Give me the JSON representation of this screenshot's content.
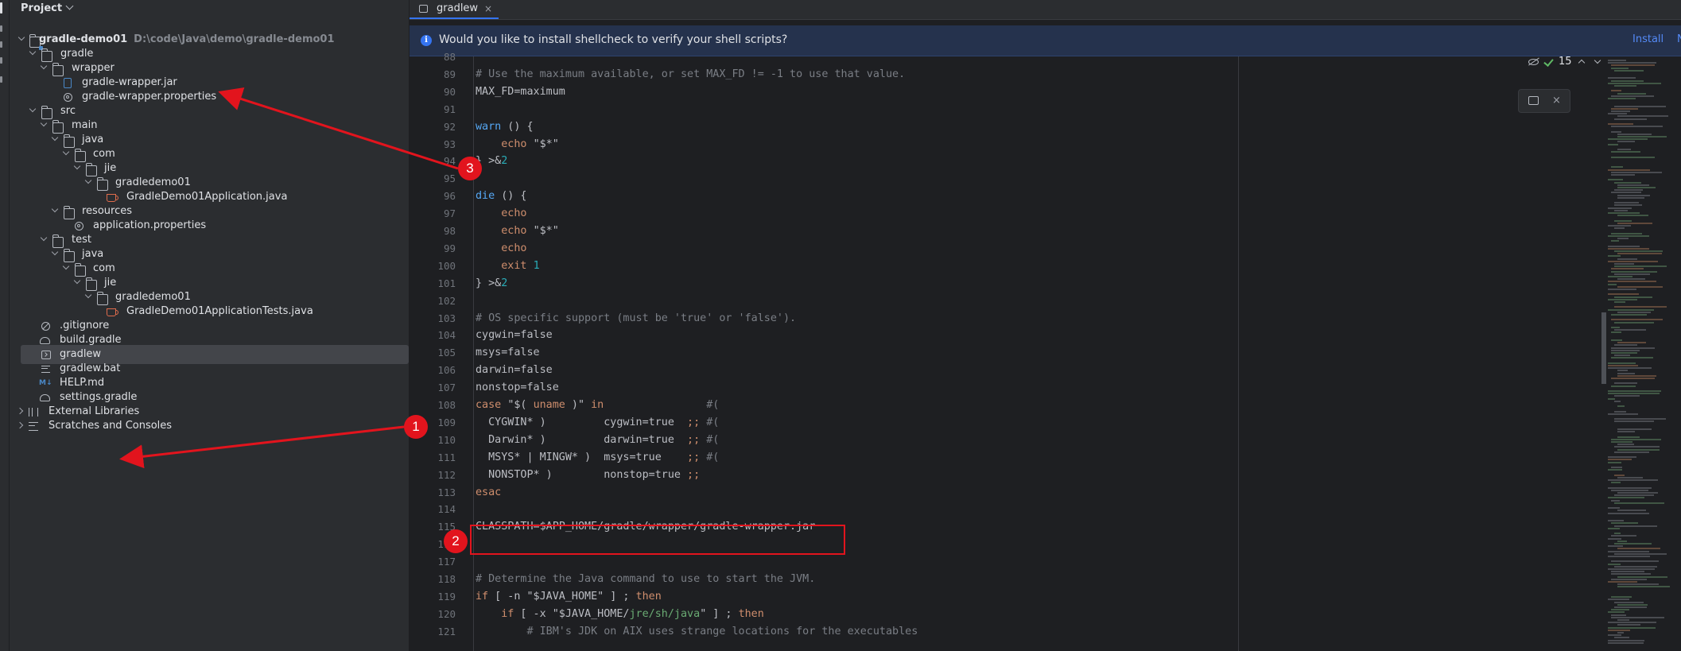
{
  "project_panel": {
    "title": "Project",
    "tree": [
      {
        "label": "gradle-demo01",
        "hint": "D:\\code\\Java\\demo\\gradle-demo01",
        "bold": true
      },
      {
        "label": "gradle"
      },
      {
        "label": "wrapper"
      },
      {
        "label": "gradle-wrapper.jar"
      },
      {
        "label": "gradle-wrapper.properties"
      },
      {
        "label": "src"
      },
      {
        "label": "main"
      },
      {
        "label": "java"
      },
      {
        "label": "com"
      },
      {
        "label": "jie"
      },
      {
        "label": "gradledemo01"
      },
      {
        "label": "GradleDemo01Application.java"
      },
      {
        "label": "resources"
      },
      {
        "label": "application.properties"
      },
      {
        "label": "test"
      },
      {
        "label": "java"
      },
      {
        "label": "com"
      },
      {
        "label": "jie"
      },
      {
        "label": "gradledemo01"
      },
      {
        "label": "GradleDemo01ApplicationTests.java"
      },
      {
        "label": ".gitignore"
      },
      {
        "label": "build.gradle"
      },
      {
        "label": "gradlew"
      },
      {
        "label": "gradlew.bat"
      },
      {
        "label": "HELP.md"
      },
      {
        "label": "settings.gradle"
      },
      {
        "label": "External Libraries"
      },
      {
        "label": "Scratches and Consoles"
      }
    ]
  },
  "editor": {
    "tab_label": "gradlew",
    "tab_close": "×",
    "notification": {
      "text": "Would you like to install shellcheck to verify your shell scripts?",
      "install": "Install",
      "no": "N"
    },
    "inspection_count": "15",
    "popup_close": "×",
    "line_numbers": [
      "88",
      "89",
      "90",
      "91",
      "92",
      "93",
      "94",
      "95",
      "96",
      "97",
      "98",
      "99",
      "100",
      "101",
      "102",
      "103",
      "104",
      "105",
      "106",
      "107",
      "108",
      "109",
      "110",
      "111",
      "112",
      "113",
      "114",
      "115",
      "116",
      "117",
      "118",
      "119",
      "120",
      "121"
    ],
    "code": [
      [],
      [
        {
          "t": "# Use the maximum available, or set MAX_FD != -1 to use that value.",
          "c": "cm"
        }
      ],
      [
        {
          "t": "MAX_FD=maximum",
          "c": ""
        }
      ],
      [],
      [
        {
          "t": "warn",
          "c": "fn"
        },
        {
          "t": " () {",
          "c": ""
        }
      ],
      [
        {
          "t": "    echo ",
          "c": "kw"
        },
        {
          "t": "\"$*\"",
          "c": ""
        }
      ],
      [
        {
          "t": "} >&",
          "c": ""
        },
        {
          "t": "2",
          "c": "nm"
        }
      ],
      [],
      [
        {
          "t": "die",
          "c": "fn"
        },
        {
          "t": " () {",
          "c": ""
        }
      ],
      [
        {
          "t": "    echo",
          "c": "kw"
        }
      ],
      [
        {
          "t": "    echo ",
          "c": "kw"
        },
        {
          "t": "\"$*\"",
          "c": ""
        }
      ],
      [
        {
          "t": "    echo",
          "c": "kw"
        }
      ],
      [
        {
          "t": "    exit ",
          "c": "kw"
        },
        {
          "t": "1",
          "c": "nm"
        }
      ],
      [
        {
          "t": "} >&",
          "c": ""
        },
        {
          "t": "2",
          "c": "nm"
        }
      ],
      [],
      [
        {
          "t": "# OS specific support (must be 'true' or 'false').",
          "c": "cm"
        }
      ],
      [
        {
          "t": "cygwin=false",
          "c": ""
        }
      ],
      [
        {
          "t": "msys=false",
          "c": ""
        }
      ],
      [
        {
          "t": "darwin=false",
          "c": ""
        }
      ],
      [
        {
          "t": "nonstop=false",
          "c": ""
        }
      ],
      [
        {
          "t": "case ",
          "c": "kw"
        },
        {
          "t": "\"$( ",
          "c": ""
        },
        {
          "t": "uname",
          "c": "kw"
        },
        {
          "t": " )\" ",
          "c": ""
        },
        {
          "t": "in",
          "c": "kw"
        },
        {
          "t": "                #(",
          "c": "cm"
        }
      ],
      [
        {
          "t": "  CYGWIN* )         cygwin=true  ",
          "c": ""
        },
        {
          "t": ";;",
          "c": "op"
        },
        {
          "t": " #(",
          "c": "cm"
        }
      ],
      [
        {
          "t": "  Darwin* )         darwin=true  ",
          "c": ""
        },
        {
          "t": ";;",
          "c": "op"
        },
        {
          "t": " #(",
          "c": "cm"
        }
      ],
      [
        {
          "t": "  MSYS* | MINGW* )  msys=true    ",
          "c": ""
        },
        {
          "t": ";;",
          "c": "op"
        },
        {
          "t": " #(",
          "c": "cm"
        }
      ],
      [
        {
          "t": "  NONSTOP* )        nonstop=true ",
          "c": ""
        },
        {
          "t": ";;",
          "c": "op"
        }
      ],
      [
        {
          "t": "esac",
          "c": "kw"
        }
      ],
      [],
      [
        {
          "t": "CLASSPATH=$APP_HOME/gradle/wrapper/gradle-wrapper.jar",
          "c": ""
        }
      ],
      [],
      [],
      [
        {
          "t": "# Determine the Java command to use to start the JVM.",
          "c": "cm"
        }
      ],
      [
        {
          "t": "if",
          "c": "kw"
        },
        {
          "t": " [ -n ",
          "c": ""
        },
        {
          "t": "\"$JAVA_HOME\"",
          "c": ""
        },
        {
          "t": " ] ; ",
          "c": ""
        },
        {
          "t": "then",
          "c": "kw"
        }
      ],
      [
        {
          "t": "    if",
          "c": "kw"
        },
        {
          "t": " [ -x ",
          "c": ""
        },
        {
          "t": "\"$JAVA_HOME/",
          "c": ""
        },
        {
          "t": "jre/sh/java",
          "c": "st"
        },
        {
          "t": "\"",
          "c": ""
        },
        {
          "t": " ] ; ",
          "c": ""
        },
        {
          "t": "then",
          "c": "kw"
        }
      ],
      [
        {
          "t": "        # IBM's JDK on AIX uses strange locations for the executables",
          "c": "cm"
        }
      ]
    ]
  },
  "annotations": {
    "badges": [
      "1",
      "2",
      "3"
    ],
    "color": "#e2141d"
  },
  "colors": {
    "accent": "#3574f0",
    "panel_bg": "#2b2d30",
    "editor_bg": "#1e1f22"
  }
}
